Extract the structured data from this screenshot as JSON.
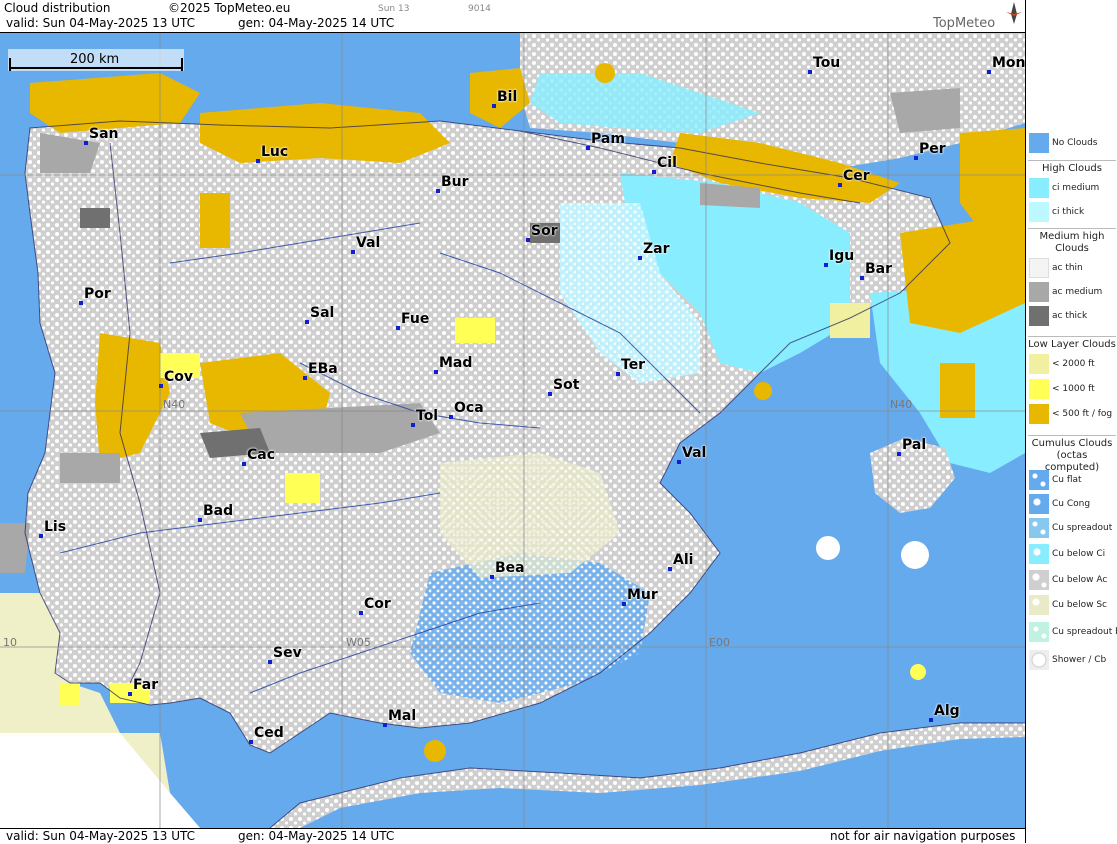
{
  "header": {
    "title": "Cloud distribution",
    "copyright": "©2025 TopMeteo.eu",
    "valid": "valid:  Sun  04-May-2025  13 UTC",
    "gen": "gen: 04-May-2025 14 UTC",
    "day_label": "Sun 13",
    "code": "9014",
    "brand": "TopMeteo"
  },
  "footer": {
    "valid": "valid:  Sun  04-May-2025  13 UTC",
    "gen": "gen: 04-May-2025 14 UTC",
    "disclaimer": "not for air navigation purposes"
  },
  "map": {
    "scale_label": "200 km",
    "grid_labels": [
      "N40",
      "N40",
      "W05",
      "E00",
      "10"
    ],
    "colors": {
      "no_clouds": "#66aaee",
      "ci_medium": "#88eeff",
      "ci_thick": "#bbf8ff",
      "low_2000": "#f0f0a0",
      "low_1000": "#ffff55",
      "low_500": "#e8b800",
      "ac_medium": "#a8a8a8",
      "ac_thick": "#707070"
    },
    "cities": [
      {
        "name": "San"
      },
      {
        "name": "Luc"
      },
      {
        "name": "Bil"
      },
      {
        "name": "Pam"
      },
      {
        "name": "Tou"
      },
      {
        "name": "Mon"
      },
      {
        "name": "Per"
      },
      {
        "name": "Cil"
      },
      {
        "name": "Bur"
      },
      {
        "name": "Cer"
      },
      {
        "name": "Sor"
      },
      {
        "name": "Val"
      },
      {
        "name": "Zar"
      },
      {
        "name": "Igu"
      },
      {
        "name": "Bar"
      },
      {
        "name": "Por"
      },
      {
        "name": "Sal"
      },
      {
        "name": "Fue"
      },
      {
        "name": "Mad"
      },
      {
        "name": "Cov"
      },
      {
        "name": "EBa"
      },
      {
        "name": "Sot"
      },
      {
        "name": "Ter"
      },
      {
        "name": "Tol"
      },
      {
        "name": "Oca"
      },
      {
        "name": "Pal"
      },
      {
        "name": "Cac"
      },
      {
        "name": "Val"
      },
      {
        "name": "Bad"
      },
      {
        "name": "Lis"
      },
      {
        "name": "Bea"
      },
      {
        "name": "Ali"
      },
      {
        "name": "Cor"
      },
      {
        "name": "Mur"
      },
      {
        "name": "Sev"
      },
      {
        "name": "Far"
      },
      {
        "name": "Alg"
      },
      {
        "name": "Mal"
      },
      {
        "name": "Ced"
      }
    ]
  },
  "legend": {
    "items": [
      {
        "type": "item",
        "label": "No Clouds",
        "icon": "no-clouds-swatch"
      },
      {
        "type": "head",
        "label": "High Clouds"
      },
      {
        "type": "item",
        "label": "ci medium",
        "icon": "ci-medium-swatch"
      },
      {
        "type": "item",
        "label": "ci thick",
        "icon": "ci-thick-swatch"
      },
      {
        "type": "head",
        "label": "Medium high Clouds"
      },
      {
        "type": "item",
        "label": "ac thin",
        "icon": "ac-thin-swatch"
      },
      {
        "type": "item",
        "label": "ac medium",
        "icon": "ac-medium-swatch"
      },
      {
        "type": "item",
        "label": "ac thick",
        "icon": "ac-thick-swatch"
      },
      {
        "type": "head",
        "label": "Low Layer Clouds"
      },
      {
        "type": "item",
        "label": "< 2000 ft",
        "icon": "low-2000-swatch"
      },
      {
        "type": "item",
        "label": "< 1000 ft",
        "icon": "low-1000-swatch"
      },
      {
        "type": "item",
        "label": "< 500 ft / fog",
        "icon": "low-500-swatch"
      },
      {
        "type": "head",
        "label": "Cumulus Clouds (octas computed)"
      },
      {
        "type": "item",
        "label": "Cu flat",
        "icon": "cu-flat-swatch"
      },
      {
        "type": "item",
        "label": "Cu Cong",
        "icon": "cu-cong-swatch"
      },
      {
        "type": "item",
        "label": "Cu spreadout",
        "icon": "cu-spreadout-swatch"
      },
      {
        "type": "item",
        "label": "Cu below Ci",
        "icon": "cu-below-ci-swatch"
      },
      {
        "type": "item",
        "label": "Cu below Ac",
        "icon": "cu-below-ac-swatch"
      },
      {
        "type": "item",
        "label": "Cu below Sc",
        "icon": "cu-below-sc-swatch"
      },
      {
        "type": "item",
        "label": "Cu spreadout below Ci",
        "icon": "cu-spreadout-below-ci-swatch"
      },
      {
        "type": "item",
        "label": "Shower / Cb",
        "icon": "shower-cb-swatch"
      }
    ]
  }
}
